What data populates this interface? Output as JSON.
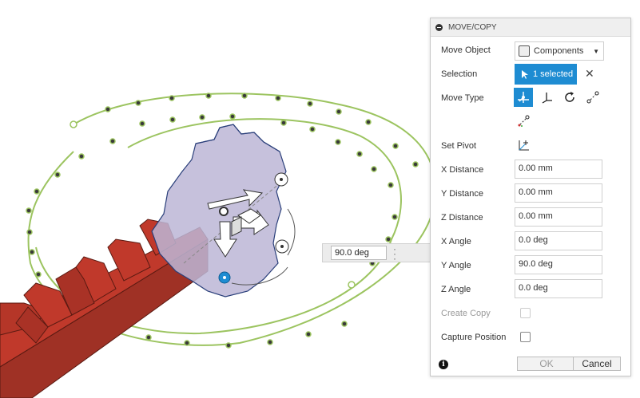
{
  "viewport": {
    "angle_input_value": "90.0 deg",
    "colors": {
      "rack": "#c0392b",
      "gear_fill": "#bcb6d6",
      "path": "#9cc460"
    }
  },
  "panel": {
    "title": "MOVE/COPY",
    "move_object": {
      "label": "Move Object",
      "value": "Components"
    },
    "selection": {
      "label": "Selection",
      "value": "1 selected"
    },
    "move_type": {
      "label": "Move Type"
    },
    "set_pivot": {
      "label": "Set Pivot"
    },
    "fields": [
      {
        "label": "X Distance",
        "value": "0.00 mm"
      },
      {
        "label": "Y Distance",
        "value": "0.00 mm"
      },
      {
        "label": "Z Distance",
        "value": "0.00 mm"
      },
      {
        "label": "X Angle",
        "value": "0.0 deg"
      },
      {
        "label": "Y Angle",
        "value": "90.0 deg"
      },
      {
        "label": "Z Angle",
        "value": "0.0 deg"
      }
    ],
    "create_copy": {
      "label": "Create Copy"
    },
    "capture_position": {
      "label": "Capture Position"
    },
    "ok_label": "OK",
    "cancel_label": "Cancel",
    "accent": "#1e8cd2"
  }
}
